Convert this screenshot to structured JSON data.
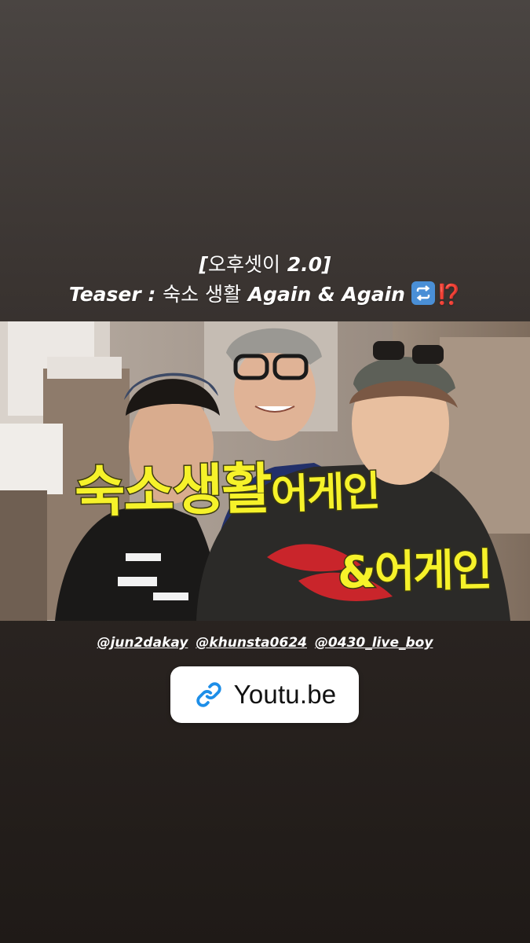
{
  "caption": {
    "line1_bracket_open": "[",
    "line1_korean": "오후셋이",
    "line1_version": "2.0",
    "line1_bracket_close": "]",
    "line2_teaser": "Teaser :",
    "line2_korean": "숙소 생활",
    "line2_again": "Again & Again",
    "line2_repeat_emoji": "repeat-button-icon",
    "line2_interrobang": "⁉️"
  },
  "video": {
    "overlay_text_line1_big": "숙소생활",
    "overlay_text_line1_small": "어게인",
    "overlay_text_line2": "&어게인",
    "overlay_color": "#f6f22a"
  },
  "mentions": [
    "@jun2dakay",
    "@khunsta0624",
    "@0430_live_boy"
  ],
  "link_sticker": {
    "icon": "link-icon",
    "text": "Youtu.be",
    "icon_color": "#1d8ee8"
  }
}
